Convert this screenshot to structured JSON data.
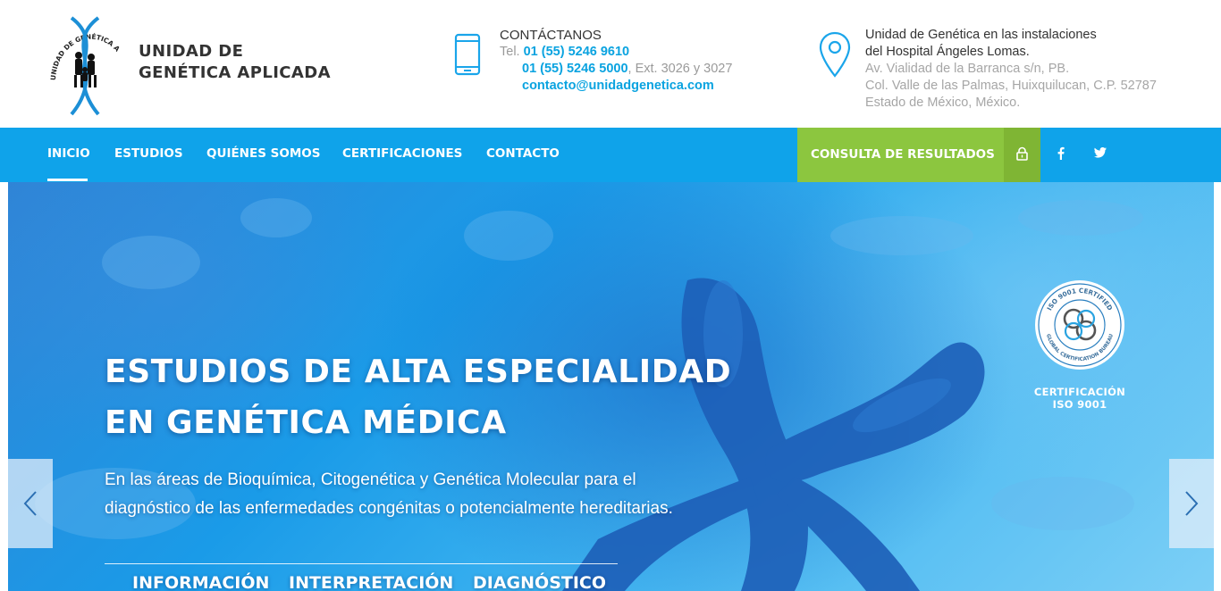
{
  "header": {
    "logo_text": "UNIDAD DE GENÉTICA APLICADA, S.C.",
    "brand_line1": "UNIDAD DE",
    "brand_line2": "GENÉTICA APLICADA",
    "contact": {
      "title": "CONTÁCTANOS",
      "tel_label": "Tel.",
      "phone1": "01 (55) 5246 9610",
      "phone2": "01 (55) 5246 5000",
      "ext": ", Ext. 3026 y 3027",
      "email": "contacto@unidadgenetica.com"
    },
    "address": {
      "line1": "Unidad de Genética en las instalaciones",
      "line2": "del Hospital Ángeles Lomas.",
      "line3": "Av. Vialidad de la Barranca s/n, PB.",
      "line4": "Col. Valle de las Palmas, Huixquilucan, C.P. 52787",
      "line5": "Estado de México, México."
    }
  },
  "nav": {
    "items": [
      {
        "label": "INICIO"
      },
      {
        "label": "ESTUDIOS"
      },
      {
        "label": "QUIÉNES SOMOS"
      },
      {
        "label": "CERTIFICACIONES"
      },
      {
        "label": "CONTACTO"
      }
    ],
    "active": "INICIO",
    "results_label": "CONSULTA DE RESULTADOS",
    "social": [
      "facebook-icon",
      "twitter-icon"
    ]
  },
  "hero": {
    "title_line1": "ESTUDIOS DE ALTA ESPECIALIDAD",
    "title_line2": "EN GENÉTICA MÉDICA",
    "subtitle": "En las áreas de Bioquímica, Citogenética y Genética Molecular para el diagnóstico de las enfermedades congénitas o potencialmente hereditarias.",
    "pills": [
      "INFORMACIÓN",
      "INTERPRETACIÓN",
      "DIAGNÓSTICO"
    ],
    "badge": {
      "ring_top": "ISO 9001 CERTIFIED",
      "ring_bottom": "GLOBAL CERTIFICATION BUREAU",
      "caption_line1": "CERTIFICACIÓN",
      "caption_line2": "ISO 9001"
    }
  },
  "colors": {
    "primary_blue": "#0fa3ea",
    "accent_green": "#8cc63f",
    "link_blue": "#0aa3e0"
  }
}
